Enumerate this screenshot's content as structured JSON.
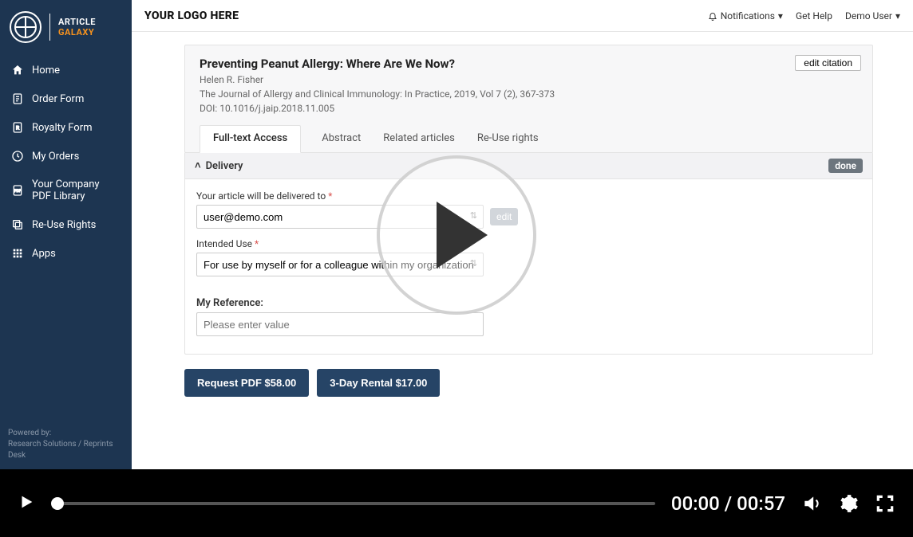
{
  "brand": {
    "line1": "ARTICLE",
    "line2": "GALAXY"
  },
  "sidebar": {
    "items": [
      {
        "label": "Home"
      },
      {
        "label": "Order Form"
      },
      {
        "label": "Royalty Form"
      },
      {
        "label": "My Orders"
      },
      {
        "label": "Your Company PDF Library"
      },
      {
        "label": "Re-Use Rights"
      },
      {
        "label": "Apps"
      }
    ],
    "powered_label": "Powered by:",
    "powered_text": "Research Solutions / Reprints Desk"
  },
  "topbar": {
    "logo_placeholder": "YOUR LOGO HERE",
    "notifications": "Notifications",
    "get_help": "Get Help",
    "user": "Demo User"
  },
  "citation": {
    "title": "Preventing Peanut Allergy: Where Are We Now?",
    "author": "Helen R. Fisher",
    "journal": "The Journal of Allergy and Clinical Immunology: In Practice, 2019, Vol 7 (2), 367-373",
    "doi": "DOI: 10.1016/j.jaip.2018.11.005",
    "edit_label": "edit citation"
  },
  "tabs": {
    "items": [
      {
        "label": "Full-text Access"
      },
      {
        "label": "Abstract"
      },
      {
        "label": "Related articles"
      },
      {
        "label": "Re-Use rights"
      }
    ]
  },
  "delivery": {
    "section_title": "Delivery",
    "done_label": "done",
    "email_label": "Your article will be delivered to ",
    "email_value": "user@demo.com",
    "email_edit": "edit",
    "use_label": "Intended Use ",
    "use_value": "For use by myself or for a colleague within my organization",
    "ref_label": "My Reference:",
    "ref_placeholder": "Please enter value"
  },
  "cta": {
    "request": "Request PDF $58.00",
    "rental": "3-Day Rental $17.00"
  },
  "player": {
    "current": "00:00",
    "duration": "00:57"
  }
}
